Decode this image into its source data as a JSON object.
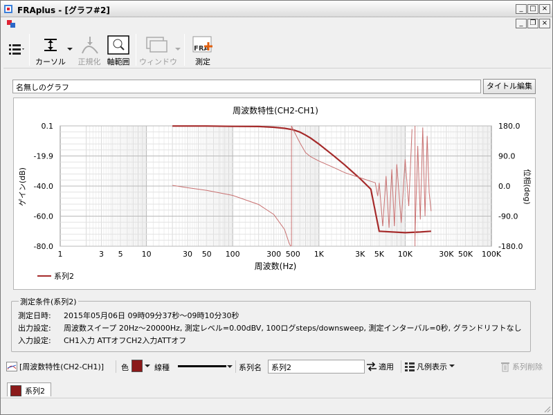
{
  "window": {
    "title": "FRAplus - [グラフ#2]"
  },
  "toolbar": {
    "cursor_label": "カーソル",
    "normalize_label": "正規化",
    "axis_range_label": "軸範囲",
    "window_label": "ウィンドウ",
    "measure_label": "測定",
    "measure_badge": "FRA"
  },
  "graph": {
    "name": "名無しのグラフ",
    "title_edit_label": "タイトル編集"
  },
  "chart_data": {
    "type": "line",
    "title": "周波数特性(CH2-CH1)",
    "xlabel": "周波数(Hz)",
    "ylabel": "ゲイン(dB)",
    "y2label": "位相(deg)",
    "x_scale": "log",
    "xlim": [
      1,
      100000
    ],
    "ylim": [
      -80,
      0.1
    ],
    "y2lim": [
      -180,
      180
    ],
    "x_ticks": [
      "1",
      "3",
      "5",
      "10",
      "30",
      "50",
      "100",
      "300",
      "500",
      "1K",
      "3K",
      "5K",
      "10K",
      "30K",
      "50K",
      "100K"
    ],
    "x_tick_values": [
      1,
      3,
      5,
      10,
      30,
      50,
      100,
      300,
      500,
      1000,
      3000,
      5000,
      10000,
      30000,
      50000,
      100000
    ],
    "y_ticks": [
      "0.1",
      "-19.9",
      "-40.0",
      "-60.0",
      "-80.0"
    ],
    "y_tick_values": [
      0.1,
      -19.9,
      -40,
      -60,
      -80
    ],
    "y2_ticks": [
      "180.0",
      "90.0",
      "0.0",
      "-90.0",
      "-180.0"
    ],
    "y2_tick_values": [
      180,
      90,
      0,
      -90,
      -180
    ],
    "grid": true,
    "legend_position": "bottom-left",
    "series": [
      {
        "name": "系列2",
        "axis": "left",
        "color": "#a52a2a",
        "x": [
          20,
          50,
          100,
          200,
          300,
          400,
          500,
          600,
          700,
          800,
          1000,
          1500,
          2000,
          3000,
          4000,
          5000,
          10000,
          15000,
          20000
        ],
        "y": [
          0,
          0,
          -0.2,
          -0.3,
          -0.8,
          -1.5,
          -2.5,
          -4,
          -6,
          -8,
          -12,
          -20,
          -26,
          -35,
          -42,
          -70,
          -71,
          -70.5,
          -70
        ]
      },
      {
        "axis": "right",
        "color": "#c87070",
        "x": [
          20,
          30,
          50,
          100,
          200,
          300,
          400,
          450,
          470,
          480,
          500,
          600,
          700,
          800,
          1000,
          1500,
          2000,
          3000,
          4000,
          4500,
          4800,
          5000,
          5500,
          6000,
          6500,
          7000,
          7500,
          8000,
          9000,
          10000,
          11000,
          12000,
          13000,
          14000,
          15000,
          16000,
          17000,
          18000,
          19000,
          20000
        ],
        "y": [
          2,
          -5,
          -13,
          -28,
          -55,
          -85,
          -130,
          -170,
          -180,
          180,
          170,
          130,
          100,
          88,
          75,
          55,
          40,
          25,
          14,
          10,
          -30,
          10,
          -120,
          30,
          -125,
          50,
          -120,
          65,
          -110,
          80,
          -60,
          170,
          -150,
          120,
          -100,
          175,
          -90,
          150,
          -20,
          -75
        ]
      }
    ]
  },
  "conditions": {
    "legend": "測定条件(系列2)",
    "date_label": "測定日時:",
    "date_value": "2015年05月06日 09時09分37秒～09時10分30秒",
    "output_label": "出力設定:",
    "output_value": "周波数スイープ 20Hz～20000Hz, 測定レベル=0.00dBV, 100ログsteps/downsweep, 測定インターバル=0秒, グランドリフトなし",
    "input_label": "入力設定:",
    "input_value": "CH1入力 ATTオフCH2入力ATTオフ"
  },
  "series_bar": {
    "graph_label": "[周波数特性(CH2-CH1)]",
    "color_label": "色",
    "color_value": "#8b1a1a",
    "linetype_label": "線種",
    "series_name_label": "系列名",
    "series_name_value": "系列2",
    "apply_label": "適用",
    "legend_label": "凡例表示",
    "delete_label": "系列削除"
  },
  "tabs": [
    {
      "label": "系列2",
      "color": "#8b1a1a"
    }
  ]
}
